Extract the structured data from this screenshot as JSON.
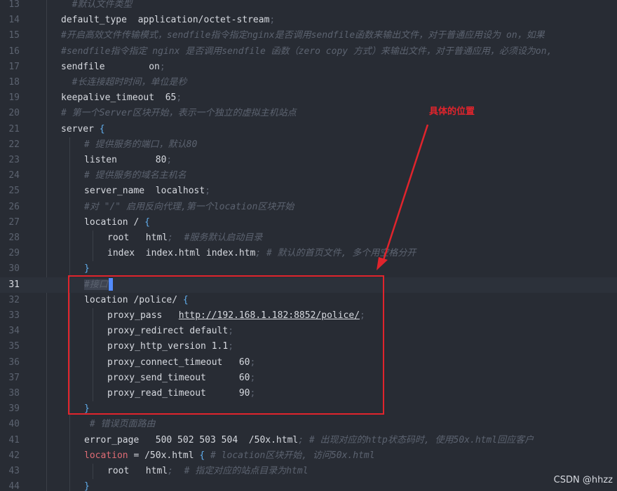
{
  "colors": {
    "background": "#282c34",
    "comment": "#5c6370",
    "text": "#d7dae0",
    "keyword_location": "#e06c75",
    "bracket": "#61afef",
    "annotation_red": "#e0242c"
  },
  "lines": [
    {
      "num": "13",
      "indent": 1,
      "parts": [
        {
          "t": "  #默认文件类型",
          "cls": "c"
        }
      ]
    },
    {
      "num": "14",
      "indent": 1,
      "parts": [
        {
          "t": "default_type  application/octet-stream",
          "cls": "k"
        },
        {
          "t": ";",
          "cls": "s"
        }
      ]
    },
    {
      "num": "15",
      "indent": 1,
      "parts": [
        {
          "t": "#开启高效文件传输模式，sendfile指令指定nginx是否调用sendfile函数来输出文件，对于普通应用设为 on，如果",
          "cls": "c"
        }
      ]
    },
    {
      "num": "16",
      "indent": 1,
      "parts": [
        {
          "t": "#sendfile指令指定 nginx 是否调用sendfile 函数（zero copy 方式）来输出文件，对于普通应用，必须设为on,",
          "cls": "c"
        }
      ]
    },
    {
      "num": "17",
      "indent": 1,
      "parts": [
        {
          "t": "sendfile        on",
          "cls": "k"
        },
        {
          "t": ";",
          "cls": "s"
        }
      ]
    },
    {
      "num": "18",
      "indent": 1,
      "parts": [
        {
          "t": "  #长连接超时时间，单位是秒",
          "cls": "c"
        }
      ]
    },
    {
      "num": "19",
      "indent": 1,
      "parts": [
        {
          "t": "keepalive_timeout  65",
          "cls": "k"
        },
        {
          "t": ";",
          "cls": "s"
        }
      ]
    },
    {
      "num": "20",
      "indent": 1,
      "parts": [
        {
          "t": "# 第一个Server区块开始，表示一个独立的虚拟主机站点",
          "cls": "c"
        }
      ]
    },
    {
      "num": "21",
      "indent": 1,
      "parts": [
        {
          "t": "server ",
          "cls": "k"
        },
        {
          "t": "{",
          "cls": "br"
        }
      ]
    },
    {
      "num": "22",
      "indent": 2,
      "parts": [
        {
          "t": "# 提供服务的端口，默认80",
          "cls": "c"
        }
      ]
    },
    {
      "num": "23",
      "indent": 2,
      "parts": [
        {
          "t": "listen       80",
          "cls": "k"
        },
        {
          "t": ";",
          "cls": "s"
        }
      ]
    },
    {
      "num": "24",
      "indent": 2,
      "parts": [
        {
          "t": "# 提供服务的域名主机名",
          "cls": "c"
        }
      ]
    },
    {
      "num": "25",
      "indent": 2,
      "parts": [
        {
          "t": "server_name  localhost",
          "cls": "k"
        },
        {
          "t": ";",
          "cls": "s"
        }
      ]
    },
    {
      "num": "26",
      "indent": 2,
      "parts": [
        {
          "t": "#对 \"/\" 启用反向代理,第一个location区块开始",
          "cls": "c"
        }
      ]
    },
    {
      "num": "27",
      "indent": 2,
      "parts": [
        {
          "t": "location / ",
          "cls": "k"
        },
        {
          "t": "{",
          "cls": "br"
        }
      ]
    },
    {
      "num": "28",
      "indent": 3,
      "parts": [
        {
          "t": "root   html",
          "cls": "k"
        },
        {
          "t": ";  #服务默认启动目录",
          "cls": "c"
        }
      ]
    },
    {
      "num": "29",
      "indent": 3,
      "parts": [
        {
          "t": "index  index.html index.htm",
          "cls": "k"
        },
        {
          "t": "; # 默认的首页文件, 多个用空格分开",
          "cls": "c"
        }
      ]
    },
    {
      "num": "30",
      "indent": 2,
      "parts": [
        {
          "t": "}",
          "cls": "br"
        }
      ]
    },
    {
      "num": "31",
      "indent": 2,
      "active": true,
      "parts": [
        {
          "t": "#接口",
          "cls": "c sel"
        }
      ],
      "cursor": true
    },
    {
      "num": "32",
      "indent": 2,
      "parts": [
        {
          "t": "location /police/ ",
          "cls": "k"
        },
        {
          "t": "{",
          "cls": "br"
        }
      ]
    },
    {
      "num": "33",
      "indent": 3,
      "parts": [
        {
          "t": "proxy_pass   ",
          "cls": "k"
        },
        {
          "t": "http://192.168.1.182:8852/police/",
          "cls": "u"
        },
        {
          "t": ";",
          "cls": "s"
        }
      ]
    },
    {
      "num": "34",
      "indent": 3,
      "parts": [
        {
          "t": "proxy_redirect default",
          "cls": "k"
        },
        {
          "t": ";",
          "cls": "s"
        }
      ]
    },
    {
      "num": "35",
      "indent": 3,
      "parts": [
        {
          "t": "proxy_http_version 1.1",
          "cls": "k"
        },
        {
          "t": ";",
          "cls": "s"
        }
      ]
    },
    {
      "num": "36",
      "indent": 3,
      "parts": [
        {
          "t": "proxy_connect_timeout   60",
          "cls": "k"
        },
        {
          "t": ";",
          "cls": "s"
        }
      ]
    },
    {
      "num": "37",
      "indent": 3,
      "parts": [
        {
          "t": "proxy_send_timeout      60",
          "cls": "k"
        },
        {
          "t": ";",
          "cls": "s"
        }
      ]
    },
    {
      "num": "38",
      "indent": 3,
      "parts": [
        {
          "t": "proxy_read_timeout      90",
          "cls": "k"
        },
        {
          "t": ";",
          "cls": "s"
        }
      ]
    },
    {
      "num": "39",
      "indent": 2,
      "parts": [
        {
          "t": "}",
          "cls": "br"
        }
      ]
    },
    {
      "num": "40",
      "indent": 2,
      "parts": [
        {
          "t": " # 错误页面路由",
          "cls": "c"
        }
      ]
    },
    {
      "num": "41",
      "indent": 2,
      "parts": [
        {
          "t": "error_page   500 502 503 504  /50x.html",
          "cls": "k"
        },
        {
          "t": "; # 出现对应的http状态码时, 使用50x.html回应客户",
          "cls": "c"
        }
      ]
    },
    {
      "num": "42",
      "indent": 2,
      "parts": [
        {
          "t": "location",
          "cls": "kw"
        },
        {
          "t": " = /50x.html ",
          "cls": "k"
        },
        {
          "t": "{",
          "cls": "br"
        },
        {
          "t": " # location区块开始, 访问50x.html",
          "cls": "c"
        }
      ]
    },
    {
      "num": "43",
      "indent": 3,
      "parts": [
        {
          "t": "root   html",
          "cls": "k"
        },
        {
          "t": ";  # 指定对应的站点目录为html",
          "cls": "c"
        }
      ]
    },
    {
      "num": "44",
      "indent": 2,
      "parts": [
        {
          "t": "}",
          "cls": "br"
        }
      ]
    }
  ],
  "annotation": {
    "label": "具体的位置"
  },
  "watermark": {
    "text": "CSDN @hhzz"
  }
}
